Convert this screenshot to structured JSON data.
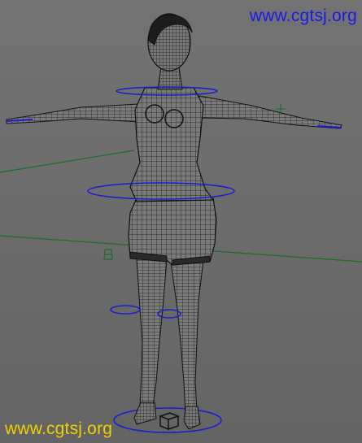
{
  "viewport": {
    "background": "#6e6e6e",
    "mesh_color": "#1a1a1a",
    "control_color": "#1b1bd0",
    "grid_line_color": "#1d6b2c"
  },
  "watermarks": {
    "top_right": "www.cgtsj.org",
    "bottom_left": "www.cgtsj.org",
    "top_color": "#1a1ae6",
    "bottom_color": "#f0d000"
  },
  "icons": {
    "locator": "light-locator-icon",
    "root": "root-cube-icon"
  }
}
